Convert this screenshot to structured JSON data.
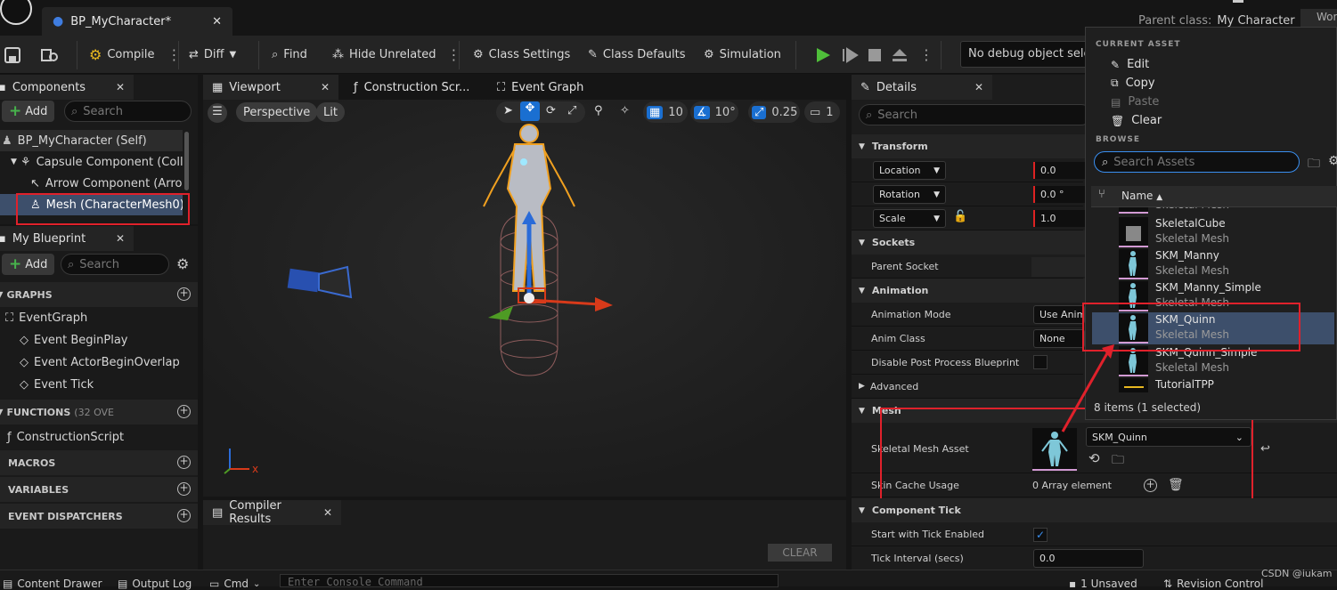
{
  "window": {
    "tab_title": "BP_MyCharacter*",
    "parent_label": "Parent class:",
    "parent_value": "My Character",
    "right_stub": "Wor"
  },
  "toolbar": {
    "compile": "Compile",
    "diff": "Diff",
    "find": "Find",
    "hide_unrelated": "Hide Unrelated",
    "class_settings": "Class Settings",
    "class_defaults": "Class Defaults",
    "simulation": "Simulation",
    "debug_object": "No debug object selected"
  },
  "components": {
    "tab": "Components",
    "add": "Add",
    "search_placeholder": "Search",
    "items": [
      "BP_MyCharacter (Self)",
      "Capsule Component (CollisionCylinder)",
      "Arrow Component (Arrow)",
      "Mesh (CharacterMesh0)"
    ]
  },
  "blueprint": {
    "tab": "My Blueprint",
    "add": "Add",
    "search_placeholder": "Search",
    "graphs": "GRAPHS",
    "event_graph": "EventGraph",
    "events": [
      "Event BeginPlay",
      "Event ActorBeginOverlap",
      "Event Tick"
    ],
    "functions": "FUNCTIONS",
    "functions_count": "(32 OVE",
    "construction_script": "ConstructionScript",
    "macros": "MACROS",
    "variables": "VARIABLES",
    "dispatchers": "EVENT DISPATCHERS"
  },
  "center_tabs": {
    "viewport": "Viewport",
    "construction": "Construction Scr...",
    "event_graph": "Event Graph"
  },
  "viewport": {
    "perspective": "Perspective",
    "lit": "Lit",
    "grid": "10",
    "angle": "10°",
    "scale": "0.25",
    "camera": "1",
    "axis_x": "x"
  },
  "compiler": {
    "tab": "Compiler Results",
    "clear": "CLEAR"
  },
  "details": {
    "tab": "Details",
    "search_placeholder": "Search",
    "transform": "Transform",
    "location": "Location",
    "location_val": "0.0",
    "rotation": "Rotation",
    "rotation_val": "0.0 °",
    "scale": "Scale",
    "scale_val": "1.0",
    "sockets": "Sockets",
    "parent_socket": "Parent Socket",
    "animation": "Animation",
    "anim_mode": "Animation Mode",
    "anim_mode_val": "Use Animation Blueprint",
    "anim_class": "Anim Class",
    "anim_class_val": "None",
    "disable_pp": "Disable Post Process Blueprint",
    "advanced": "Advanced",
    "mesh": "Mesh",
    "skeletal_mesh_asset": "Skeletal Mesh Asset",
    "skeletal_mesh_val": "SKM_Quinn",
    "skin_cache": "Skin Cache Usage",
    "skin_cache_val": "0 Array element",
    "component_tick": "Component Tick",
    "start_tick": "Start with Tick Enabled",
    "tick_interval": "Tick Interval (secs)",
    "tick_interval_val": "0.0"
  },
  "asset_picker": {
    "current_asset": "CURRENT ASSET",
    "edit": "Edit",
    "copy": "Copy",
    "paste": "Paste",
    "clear": "Clear",
    "browse": "BROWSE",
    "search_placeholder": "Search Assets",
    "col_name": "Name",
    "assets": [
      {
        "name": "",
        "type": "Skeletal Mesh"
      },
      {
        "name": "SkeletalCube",
        "type": "Skeletal Mesh"
      },
      {
        "name": "SKM_Manny",
        "type": "Skeletal Mesh"
      },
      {
        "name": "SKM_Manny_Simple",
        "type": "Skeletal Mesh"
      },
      {
        "name": "SKM_Quinn",
        "type": "Skeletal Mesh"
      },
      {
        "name": "SKM_Quinn_Simple",
        "type": "Skeletal Mesh"
      },
      {
        "name": "TutorialTPP",
        "type": ""
      }
    ],
    "count": "8 items (1 selected)"
  },
  "statusbar": {
    "content_drawer": "Content Drawer",
    "output_log": "Output Log",
    "cmd": "Cmd",
    "console_placeholder": "Enter Console Command",
    "unsaved": "1 Unsaved",
    "revision": "Revision Control"
  },
  "watermark": "CSDN @iukam",
  "colors": {
    "accent_blue": "#1a6fd1",
    "highlight_red": "#e0212b",
    "play_green": "#4fbf3a",
    "selected_row": "#3d4f6b"
  }
}
